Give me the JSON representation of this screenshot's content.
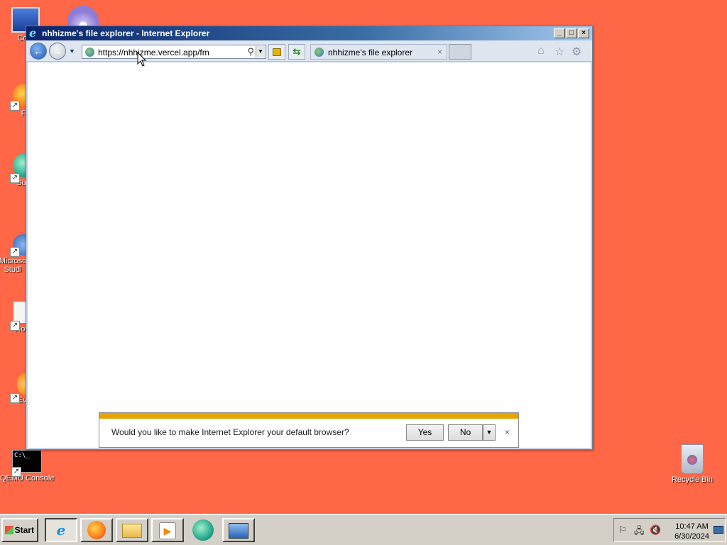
{
  "desktop": {
    "icons": [
      {
        "label": "Com",
        "glyph": "🖥"
      },
      {
        "label": "Fir",
        "glyph": "🔥"
      },
      {
        "label": "Supe",
        "glyph": "🌐"
      },
      {
        "label": "Microso Studi",
        "glyph": "⚙"
      },
      {
        "label": "Notep",
        "glyph": "📝"
      },
      {
        "label": "Ever",
        "glyph": "📦"
      },
      {
        "label": "QEMU Console",
        "glyph": "C:\\_"
      },
      {
        "label": "Recycle Bin",
        "glyph": "🗑"
      }
    ]
  },
  "window": {
    "title": "nhhizme's file explorer - Internet Explorer",
    "minimize": "_",
    "maximize": "□",
    "close": "×"
  },
  "toolbar": {
    "back_icon": "arrow-left-icon",
    "forward_icon": "arrow-right-icon",
    "address_url": "https://nhhizme.vercel.app/fm",
    "tab_title": "nhhizme's file explorer",
    "tab_close": "×"
  },
  "notification": {
    "message": "Would you like to make Internet Explorer your default browser?",
    "yes_label": "Yes",
    "no_label": "No",
    "close": "×"
  },
  "taskbar": {
    "start_label": "Start",
    "clock_time": "10:47 AM",
    "clock_date": "6/30/2024"
  },
  "colors": {
    "desktop": "#ff6747",
    "notify_stripe": "#e7a400"
  }
}
